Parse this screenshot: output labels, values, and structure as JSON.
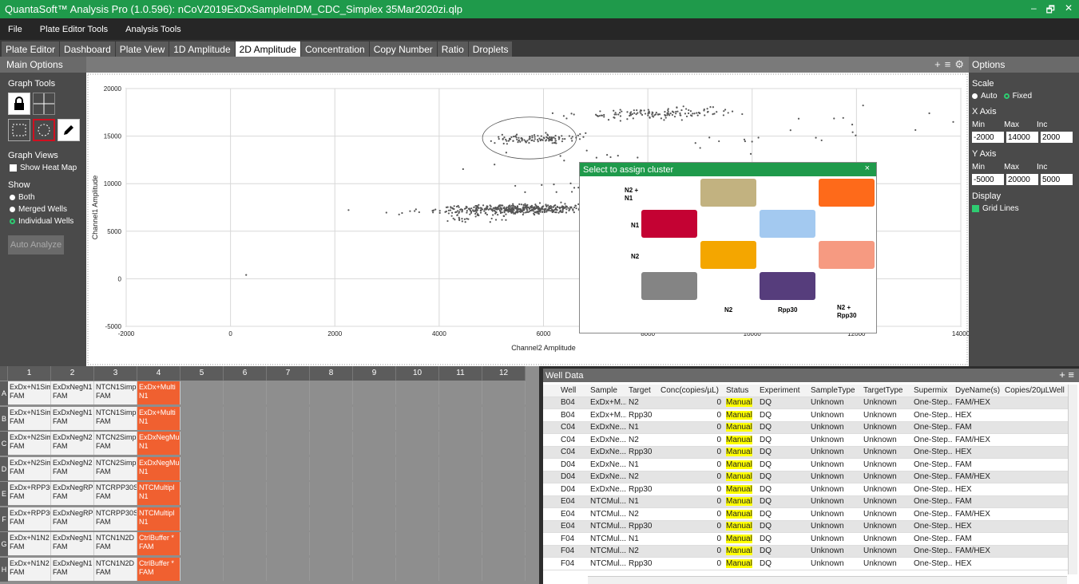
{
  "window": {
    "title": "QuantaSoft™ Analysis Pro (1.0.596): nCoV2019ExDxSampleInDM_CDC_Simplex 35Mar2020zi.qlp",
    "controls": [
      "–",
      "🗗",
      "✕"
    ]
  },
  "menu": [
    "File",
    "Plate Editor Tools",
    "Analysis Tools"
  ],
  "tabs": [
    {
      "label": "Plate Editor"
    },
    {
      "label": "Dashboard"
    },
    {
      "label": "Plate View"
    },
    {
      "label": "1D Amplitude"
    },
    {
      "label": "2D Amplitude",
      "active": true
    },
    {
      "label": "Concentration"
    },
    {
      "label": "Copy Number"
    },
    {
      "label": "Ratio"
    },
    {
      "label": "Droplets"
    }
  ],
  "left": {
    "header": "Main Options",
    "graph_tools": "Graph Tools",
    "graph_views": "Graph Views",
    "show_heat_map": "Show Heat Map",
    "show": "Show",
    "show_options": [
      "Both",
      "Merged Wells",
      "Individual Wells"
    ],
    "auto_analyze": "Auto Analyze"
  },
  "right": {
    "header": "Options",
    "scale": "Scale",
    "auto": "Auto",
    "fixed": "Fixed",
    "xaxis": "X Axis",
    "yaxis": "Y Axis",
    "min": "Min",
    "max": "Max",
    "inc": "Inc",
    "x_min": "-2000",
    "x_max": "14000",
    "x_inc": "2000",
    "y_min": "-5000",
    "y_max": "20000",
    "y_inc": "5000",
    "display": "Display",
    "grid_lines": "Grid Lines"
  },
  "chart_data": {
    "type": "scatter",
    "xlabel": "Channel2 Amplitude",
    "ylabel": "Channel1 Amplitude",
    "xlim": [
      -2000,
      14000
    ],
    "ylim": [
      -5000,
      20000
    ],
    "xticks": [
      -2000,
      0,
      2000,
      4000,
      6000,
      8000,
      10000,
      12000,
      14000
    ],
    "yticks": [
      -5000,
      0,
      5000,
      10000,
      15000,
      20000
    ],
    "xtick_labels": [
      "-2000",
      "0",
      "2000",
      "4000",
      "6000",
      "8000",
      "10000",
      "12000",
      "14000"
    ],
    "ytick_labels": [
      "-5000",
      "0",
      "5000",
      "10000",
      "15000",
      "20000"
    ],
    "grid": true,
    "clusters": [
      {
        "cx": 5500,
        "cy": 7300,
        "sx": 350,
        "sy": 250,
        "n": 450,
        "tilt": 0.12
      },
      {
        "cx": 5800,
        "cy": 14700,
        "sx": 180,
        "sy": 250,
        "n": 110,
        "tilt": 0.1
      },
      {
        "cx": 8200,
        "cy": 17400,
        "sx": 320,
        "sy": 280,
        "n": 130,
        "tilt": 0.13
      },
      {
        "cx": 4600,
        "cy": 6300,
        "sx": 120,
        "sy": 150,
        "n": 18,
        "tilt": 0
      },
      {
        "cx": 7000,
        "cy": 12800,
        "sx": 800,
        "sy": 1200,
        "n": 18,
        "tilt": 0
      },
      {
        "cx": 12000,
        "cy": 16000,
        "sx": 350,
        "sy": 900,
        "n": 12,
        "tilt": 0
      },
      {
        "cx": 10000,
        "cy": 14600,
        "sx": 500,
        "sy": 250,
        "n": 8,
        "tilt": 0
      },
      {
        "cx": 6300,
        "cy": 9500,
        "sx": 300,
        "sy": 600,
        "n": 10,
        "tilt": 0
      }
    ],
    "points": [
      [
        300,
        400
      ]
    ],
    "selection_ellipse": {
      "cx": 5730,
      "cy": 14800,
      "rx": 900,
      "ry": 2200
    }
  },
  "dialog": {
    "title": "Select to assign cluster",
    "close": "×",
    "labels": {
      "n2n1": "N2 +\nN1",
      "n1": "N1",
      "n2": "N2",
      "n2b": "N2",
      "rpp30": "Rpp30",
      "n2rpp30": "N2 +\nRpp30"
    },
    "colors": {
      "tan": "#c2b280",
      "orange": "#fe6a1a",
      "crimson": "#c40233",
      "lightblue": "#a3c9f0",
      "amber": "#f4a600",
      "salmon": "#f69a81",
      "gray": "#848484",
      "purple": "#563d7c"
    }
  },
  "plate": {
    "cols": [
      "1",
      "2",
      "3",
      "4",
      "5",
      "6",
      "7",
      "8",
      "9",
      "10",
      "11",
      "12"
    ],
    "rows": [
      {
        "label": "A",
        "cells": [
          [
            "ExDx+N1Sim",
            "FAM"
          ],
          [
            "ExDxNegN1",
            "FAM"
          ],
          [
            "NTCN1Simp",
            "FAM"
          ],
          [
            "ExDx+Multi",
            "N1"
          ]
        ]
      },
      {
        "label": "B",
        "cells": [
          [
            "ExDx+N1Sim",
            "FAM"
          ],
          [
            "ExDxNegN1",
            "FAM"
          ],
          [
            "NTCN1Simp",
            "FAM"
          ],
          [
            "ExDx+Multi",
            "N1"
          ]
        ]
      },
      {
        "label": "C",
        "cells": [
          [
            "ExDx+N2Sim",
            "FAM"
          ],
          [
            "ExDxNegN2",
            "FAM"
          ],
          [
            "NTCN2Simp",
            "FAM"
          ],
          [
            "ExDxNegMu",
            "N1"
          ]
        ]
      },
      {
        "label": "D",
        "cells": [
          [
            "ExDx+N2Sim",
            "FAM"
          ],
          [
            "ExDxNegN2",
            "FAM"
          ],
          [
            "NTCN2Simp",
            "FAM"
          ],
          [
            "ExDxNegMu",
            "N1"
          ]
        ]
      },
      {
        "label": "E",
        "cells": [
          [
            "ExDx+RPP30",
            "FAM"
          ],
          [
            "ExDxNegRP",
            "FAM"
          ],
          [
            "NTCRPP30S",
            "FAM"
          ],
          [
            "NTCMultipl",
            "N1"
          ]
        ]
      },
      {
        "label": "F",
        "cells": [
          [
            "ExDx+RPP30",
            "FAM"
          ],
          [
            "ExDxNegRP",
            "FAM"
          ],
          [
            "NTCRPP30S",
            "FAM"
          ],
          [
            "NTCMultipl",
            "N1"
          ]
        ]
      },
      {
        "label": "G",
        "cells": [
          [
            "ExDx+N1N2",
            "FAM"
          ],
          [
            "ExDxNegN1",
            "FAM"
          ],
          [
            "NTCN1N2D",
            "FAM"
          ],
          [
            "CtrlBuffer *",
            "FAM"
          ]
        ]
      },
      {
        "label": "H",
        "cells": [
          [
            "ExDx+N1N2",
            "FAM"
          ],
          [
            "ExDxNegN1",
            "FAM"
          ],
          [
            "NTCN1N2D",
            "FAM"
          ],
          [
            "CtrlBuffer *",
            "FAM"
          ]
        ]
      }
    ],
    "selected_col": 4
  },
  "well_data": {
    "title": "Well Data",
    "plus": "+ ≡",
    "columns": [
      "Well",
      "Sample",
      "Target",
      "Conc(copies/µL)",
      "Status",
      "Experiment",
      "SampleType",
      "TargetType",
      "Supermix",
      "DyeName(s)",
      "Copies/20µLWell"
    ],
    "rows": [
      [
        "B04",
        "ExDx+M...",
        "N2",
        "0",
        "Manual",
        "DQ",
        "Unknown",
        "Unknown",
        "One-Step...",
        "FAM/HEX",
        ""
      ],
      [
        "B04",
        "ExDx+M...",
        "Rpp30",
        "0",
        "Manual",
        "DQ",
        "Unknown",
        "Unknown",
        "One-Step...",
        "HEX",
        ""
      ],
      [
        "C04",
        "ExDxNe...",
        "N1",
        "0",
        "Manual",
        "DQ",
        "Unknown",
        "Unknown",
        "One-Step...",
        "FAM",
        ""
      ],
      [
        "C04",
        "ExDxNe...",
        "N2",
        "0",
        "Manual",
        "DQ",
        "Unknown",
        "Unknown",
        "One-Step...",
        "FAM/HEX",
        ""
      ],
      [
        "C04",
        "ExDxNe...",
        "Rpp30",
        "0",
        "Manual",
        "DQ",
        "Unknown",
        "Unknown",
        "One-Step...",
        "HEX",
        ""
      ],
      [
        "D04",
        "ExDxNe...",
        "N1",
        "0",
        "Manual",
        "DQ",
        "Unknown",
        "Unknown",
        "One-Step...",
        "FAM",
        ""
      ],
      [
        "D04",
        "ExDxNe...",
        "N2",
        "0",
        "Manual",
        "DQ",
        "Unknown",
        "Unknown",
        "One-Step...",
        "FAM/HEX",
        ""
      ],
      [
        "D04",
        "ExDxNe...",
        "Rpp30",
        "0",
        "Manual",
        "DQ",
        "Unknown",
        "Unknown",
        "One-Step...",
        "HEX",
        ""
      ],
      [
        "E04",
        "NTCMul...",
        "N1",
        "0",
        "Manual",
        "DQ",
        "Unknown",
        "Unknown",
        "One-Step...",
        "FAM",
        ""
      ],
      [
        "E04",
        "NTCMul...",
        "N2",
        "0",
        "Manual",
        "DQ",
        "Unknown",
        "Unknown",
        "One-Step...",
        "FAM/HEX",
        ""
      ],
      [
        "E04",
        "NTCMul...",
        "Rpp30",
        "0",
        "Manual",
        "DQ",
        "Unknown",
        "Unknown",
        "One-Step...",
        "HEX",
        ""
      ],
      [
        "F04",
        "NTCMul...",
        "N1",
        "0",
        "Manual",
        "DQ",
        "Unknown",
        "Unknown",
        "One-Step...",
        "FAM",
        ""
      ],
      [
        "F04",
        "NTCMul...",
        "N2",
        "0",
        "Manual",
        "DQ",
        "Unknown",
        "Unknown",
        "One-Step...",
        "FAM/HEX",
        ""
      ],
      [
        "F04",
        "NTCMul...",
        "Rpp30",
        "0",
        "Manual",
        "DQ",
        "Unknown",
        "Unknown",
        "One-Step...",
        "HEX",
        ""
      ]
    ]
  }
}
